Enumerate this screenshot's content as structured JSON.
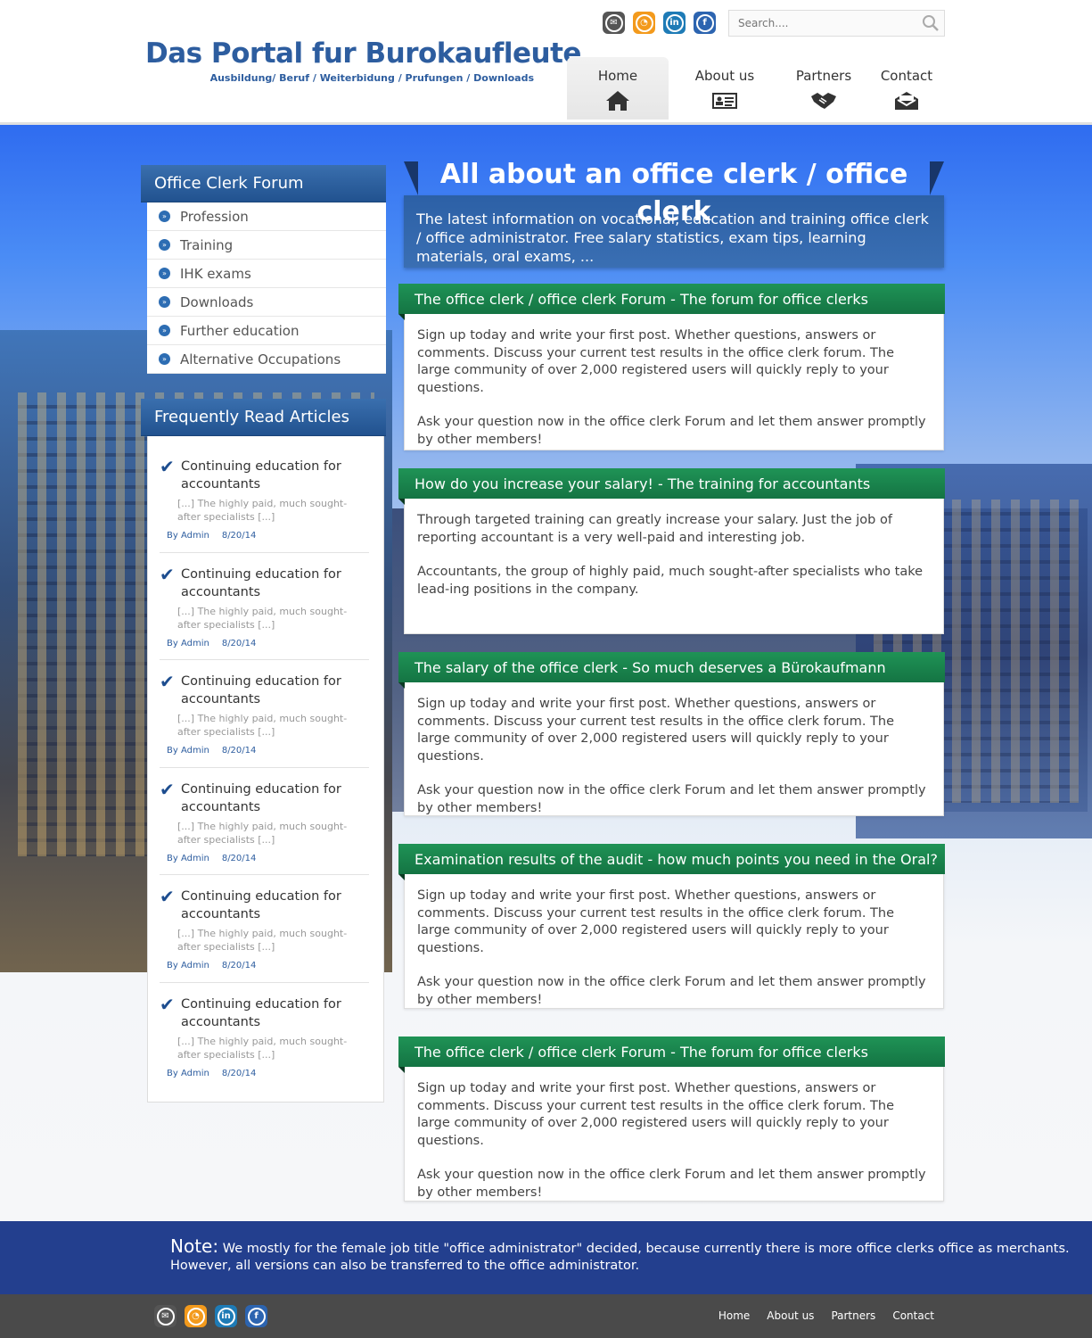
{
  "header": {
    "logo_title": "Das Portal fur Burokaufleute",
    "logo_subtitle": "Ausbildung/ Beruf / Weiterbidung / Prufungen / Downloads",
    "search_placeholder": "Search....",
    "social_icons": [
      "mail-icon",
      "rss-icon",
      "linkedin-icon",
      "facebook-icon"
    ],
    "nav": [
      {
        "label": "Home",
        "icon": "home-icon",
        "active": true
      },
      {
        "label": "About us",
        "icon": "id-card-icon",
        "active": false
      },
      {
        "label": "Partners",
        "icon": "handshake-icon",
        "active": false
      },
      {
        "label": "Contact",
        "icon": "envelope-icon",
        "active": false
      }
    ]
  },
  "sidebar": {
    "forum_title": "Office Clerk Forum",
    "forum_items": [
      "Profession",
      "Training",
      "IHK exams",
      "Downloads",
      "Further education",
      "Alternative Occupations"
    ],
    "articles_title": "Frequently Read Articles",
    "articles": [
      {
        "title": "Continuing education for accountants",
        "excerpt": "[...] The highly paid, much sought-after specialists [...]",
        "author": "By Admin",
        "date": "8/20/14"
      },
      {
        "title": "Continuing education for accountants",
        "excerpt": "[...] The highly paid, much sought-after specialists [...]",
        "author": "By Admin",
        "date": "8/20/14"
      },
      {
        "title": "Continuing education for accountants",
        "excerpt": "[...] The highly paid, much sought-after specialists [...]",
        "author": "By Admin",
        "date": "8/20/14"
      },
      {
        "title": "Continuing education for accountants",
        "excerpt": "[...] The highly paid, much sought-after specialists [...]",
        "author": "By Admin",
        "date": "8/20/14"
      },
      {
        "title": "Continuing education for accountants",
        "excerpt": "[...] The highly paid, much sought-after specialists [...]",
        "author": "By Admin",
        "date": "8/20/14"
      },
      {
        "title": "Continuing education for accountants",
        "excerpt": "[...] The highly paid, much sought-after specialists [...]",
        "author": "By Admin",
        "date": "8/20/14"
      }
    ]
  },
  "main": {
    "title": "All about an office clerk / office clerk",
    "intro": "The latest information on vocational, education and training office clerk / office administrator. Free salary statistics, exam tips, learning materials, oral exams, ...",
    "cards": [
      {
        "heading": "The office clerk / office clerk Forum - The forum for office clerks",
        "p1": "Sign up today and write your first post. Whether questions, answers or comments. Discuss your current test results in the office clerk forum. The large community of over 2,000 registered users will quickly reply to your questions.",
        "p2": "Ask your question now in the office clerk Forum and let them answer promptly by other members!"
      },
      {
        "heading": "How do you increase your salary! - The training for accountants",
        "p1": "Through targeted training can greatly increase your salary. Just the job of reporting accountant is a very well-paid and interesting job.",
        "p2": "Accountants, the group of highly paid, much sought-after specialists who take lead-ing positions in the company."
      },
      {
        "heading": "The salary of the office clerk - So much deserves a Bürokaufmann",
        "p1": "Sign up today and write your first post. Whether questions, answers or comments. Discuss your current test results in the office clerk forum. The large community of over 2,000 registered users will quickly reply to your questions.",
        "p2": "Ask your question now in the office clerk Forum and let them answer promptly by other members!"
      },
      {
        "heading": "Examination results of the audit - how much points you need in the Oral?",
        "p1": "Sign up today and write your first post. Whether questions, answers or comments. Discuss your current test results in the office clerk forum. The large community of over 2,000 registered users will quickly reply to your questions.",
        "p2": "Ask your question now in the office clerk Forum and let them answer promptly by other members!"
      },
      {
        "heading": "The office clerk / office clerk Forum - The forum for office clerks",
        "p1": "Sign up today and write your first post. Whether questions, answers or comments. Discuss your current test results in the office clerk forum. The large community of over 2,000 registered users will quickly reply to your questions.",
        "p2": "Ask your question now in the office clerk Forum and let them answer promptly by other members!"
      }
    ]
  },
  "note": {
    "label": "Note:",
    "text": " We mostly for the female job title \"office administrator\" decided, because currently there is more office clerks office as merchants. However, all versions can also be transferred to the office administrator."
  },
  "footer": {
    "nav": [
      "Home",
      "About us",
      "Partners",
      "Contact"
    ]
  },
  "colors": {
    "brand_blue": "#2d5d9f",
    "green_header": "#1f9356",
    "note_bg": "#233f8e",
    "footer_bg": "#4a4a4a"
  }
}
